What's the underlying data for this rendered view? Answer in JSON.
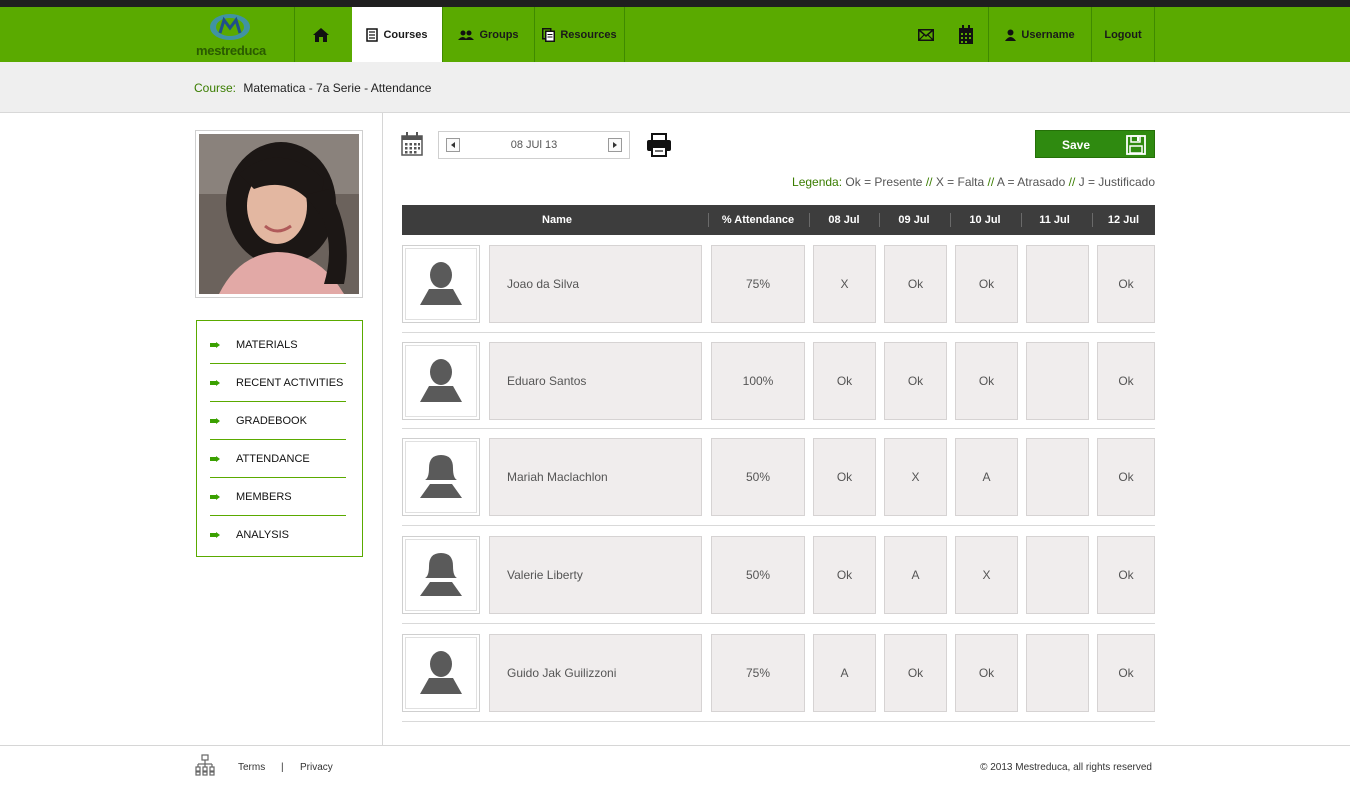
{
  "brand": {
    "name": "mestreduca",
    "color": "#5aaa00"
  },
  "nav": {
    "home_icon": "home-icon",
    "items": [
      {
        "label": "Courses",
        "icon": "document-icon",
        "active": true
      },
      {
        "label": "Groups",
        "icon": "users-icon",
        "active": false
      },
      {
        "label": "Resources",
        "icon": "pages-icon",
        "active": false
      }
    ],
    "mail_icon": "mail-icon",
    "calendar_icon": "calendar-icon",
    "username": "Username",
    "logout": "Logout"
  },
  "breadcrumb": {
    "label": "Course:",
    "value": "Matematica - 7a Serie - Attendance"
  },
  "sidebar": {
    "items": [
      {
        "label": "MATERIALS"
      },
      {
        "label": "RECENT ACTIVITIES"
      },
      {
        "label": "GRADEBOOK"
      },
      {
        "label": "ATTENDANCE"
      },
      {
        "label": "MEMBERS"
      },
      {
        "label": "ANALYSIS"
      }
    ]
  },
  "toolbar": {
    "date": "08 JUl 13",
    "save_label": "Save"
  },
  "legend": {
    "label": "Legenda:",
    "ok": "Ok = Presente",
    "sep": "//",
    "x": "X = Falta",
    "a": "A = Atrasado",
    "j": "J = Justificado"
  },
  "table": {
    "headers": [
      "Name",
      "% Attendance",
      "08 Jul",
      "09 Jul",
      "10 Jul",
      "11 Jul",
      "12 Jul"
    ],
    "rows": [
      {
        "name": "Joao da Silva",
        "gender": "male",
        "attendance": "75%",
        "days": [
          "X",
          "Ok",
          "Ok",
          "",
          "Ok"
        ]
      },
      {
        "name": "Eduaro Santos",
        "gender": "male",
        "attendance": "100%",
        "days": [
          "Ok",
          "Ok",
          "Ok",
          "",
          "Ok"
        ]
      },
      {
        "name": "Mariah Maclachlon",
        "gender": "female",
        "attendance": "50%",
        "days": [
          "Ok",
          "X",
          "A",
          "",
          "Ok"
        ]
      },
      {
        "name": "Valerie Liberty",
        "gender": "female",
        "attendance": "50%",
        "days": [
          "Ok",
          "A",
          "X",
          "",
          "Ok"
        ]
      },
      {
        "name": "Guido Jak Guilizzoni",
        "gender": "male",
        "attendance": "75%",
        "days": [
          "A",
          "Ok",
          "Ok",
          "",
          "Ok"
        ]
      }
    ]
  },
  "footer": {
    "terms": "Terms",
    "sep": "|",
    "privacy": "Privacy",
    "copyright": "© 2013 Mestreduca, all rights reserved"
  }
}
